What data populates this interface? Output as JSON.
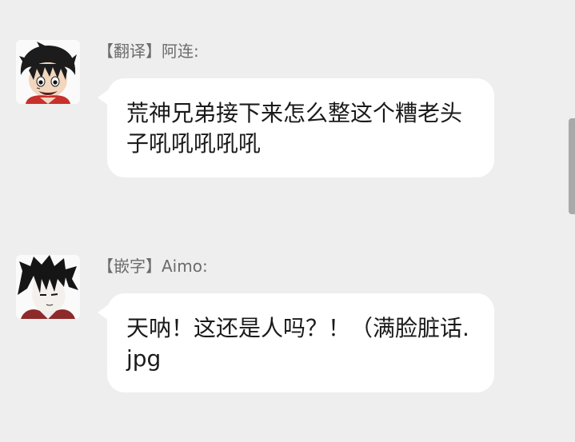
{
  "messages": [
    {
      "sender": "【翻译】阿连:",
      "text": "荒神兄弟接下来怎么整这个糟老头子吼吼吼吼吼",
      "avatar_icon": "straw-hat-character-avatar-icon"
    },
    {
      "sender": "【嵌字】Aimo:",
      "text": "天呐！这还是人吗？！（满脸脏话.jpg",
      "avatar_icon": "black-hair-character-avatar-icon"
    }
  ],
  "colors": {
    "background": "#eeeeee",
    "bubble": "#ffffff",
    "sender_text": "#6b6b6b",
    "message_text": "#1a1a1a",
    "scrollbar": "#a9a9a9"
  }
}
